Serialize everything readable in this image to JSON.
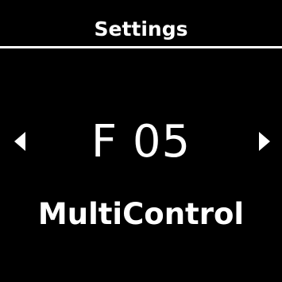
{
  "header": {
    "title": "Settings"
  },
  "setting": {
    "code": "F 05",
    "name": "MultiControl"
  },
  "navigation": {
    "previous_icon": "caret-left-icon",
    "next_icon": "caret-right-icon"
  },
  "colors": {
    "background": "#000000",
    "foreground": "#ffffff"
  }
}
